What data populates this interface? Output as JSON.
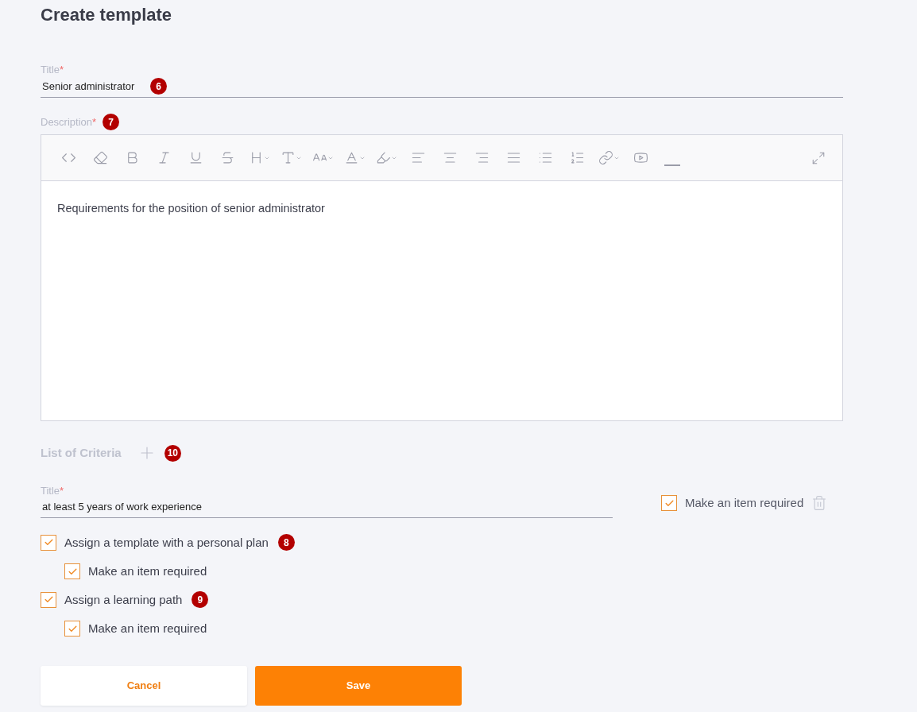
{
  "page": {
    "title": "Create template"
  },
  "title_field": {
    "label": "Title",
    "required_mark": "*",
    "value": "Senior administrator",
    "badge": "6"
  },
  "description": {
    "label": "Description",
    "required_mark": "*",
    "badge": "7",
    "text": "Requirements for the position of senior administrator"
  },
  "criteria": {
    "heading": "List of Criteria",
    "badge": "10",
    "item": {
      "label": "Title",
      "required_mark": "*",
      "value": "at least 5 years of work experience",
      "required": {
        "label": "Make an item required",
        "checked": true
      }
    },
    "options": [
      {
        "label": "Assign a template with a personal plan",
        "checked": true,
        "badge": "8",
        "sub": {
          "label": "Make an item required",
          "checked": true
        }
      },
      {
        "label": "Assign a learning path",
        "checked": true,
        "badge": "9",
        "sub": {
          "label": "Make an item required",
          "checked": true
        }
      }
    ]
  },
  "buttons": {
    "cancel": "Cancel",
    "save": "Save"
  }
}
